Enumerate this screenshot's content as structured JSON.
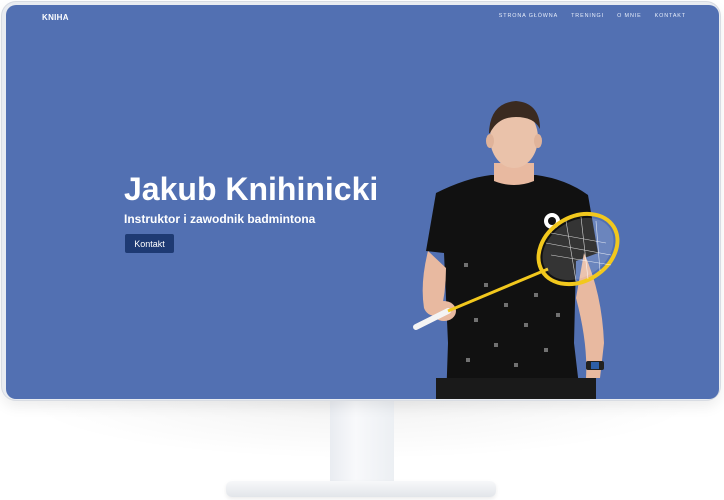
{
  "nav": {
    "brand": "KNIHA",
    "items": [
      "STRONA GŁÓWNA",
      "TRENINGI",
      "O MNIE",
      "KONTAKT"
    ]
  },
  "hero": {
    "title": "Jakub Knihinicki",
    "subtitle": "Instruktor i zawodnik badmintona",
    "button_label": "Kontakt"
  },
  "colors": {
    "hero_background": "#5270b2",
    "button_background": "#1e3a73",
    "racket_frame": "#f2c81d",
    "shirt": "#111111"
  },
  "image": {
    "semantic": "player-holding-badminton-racket"
  }
}
